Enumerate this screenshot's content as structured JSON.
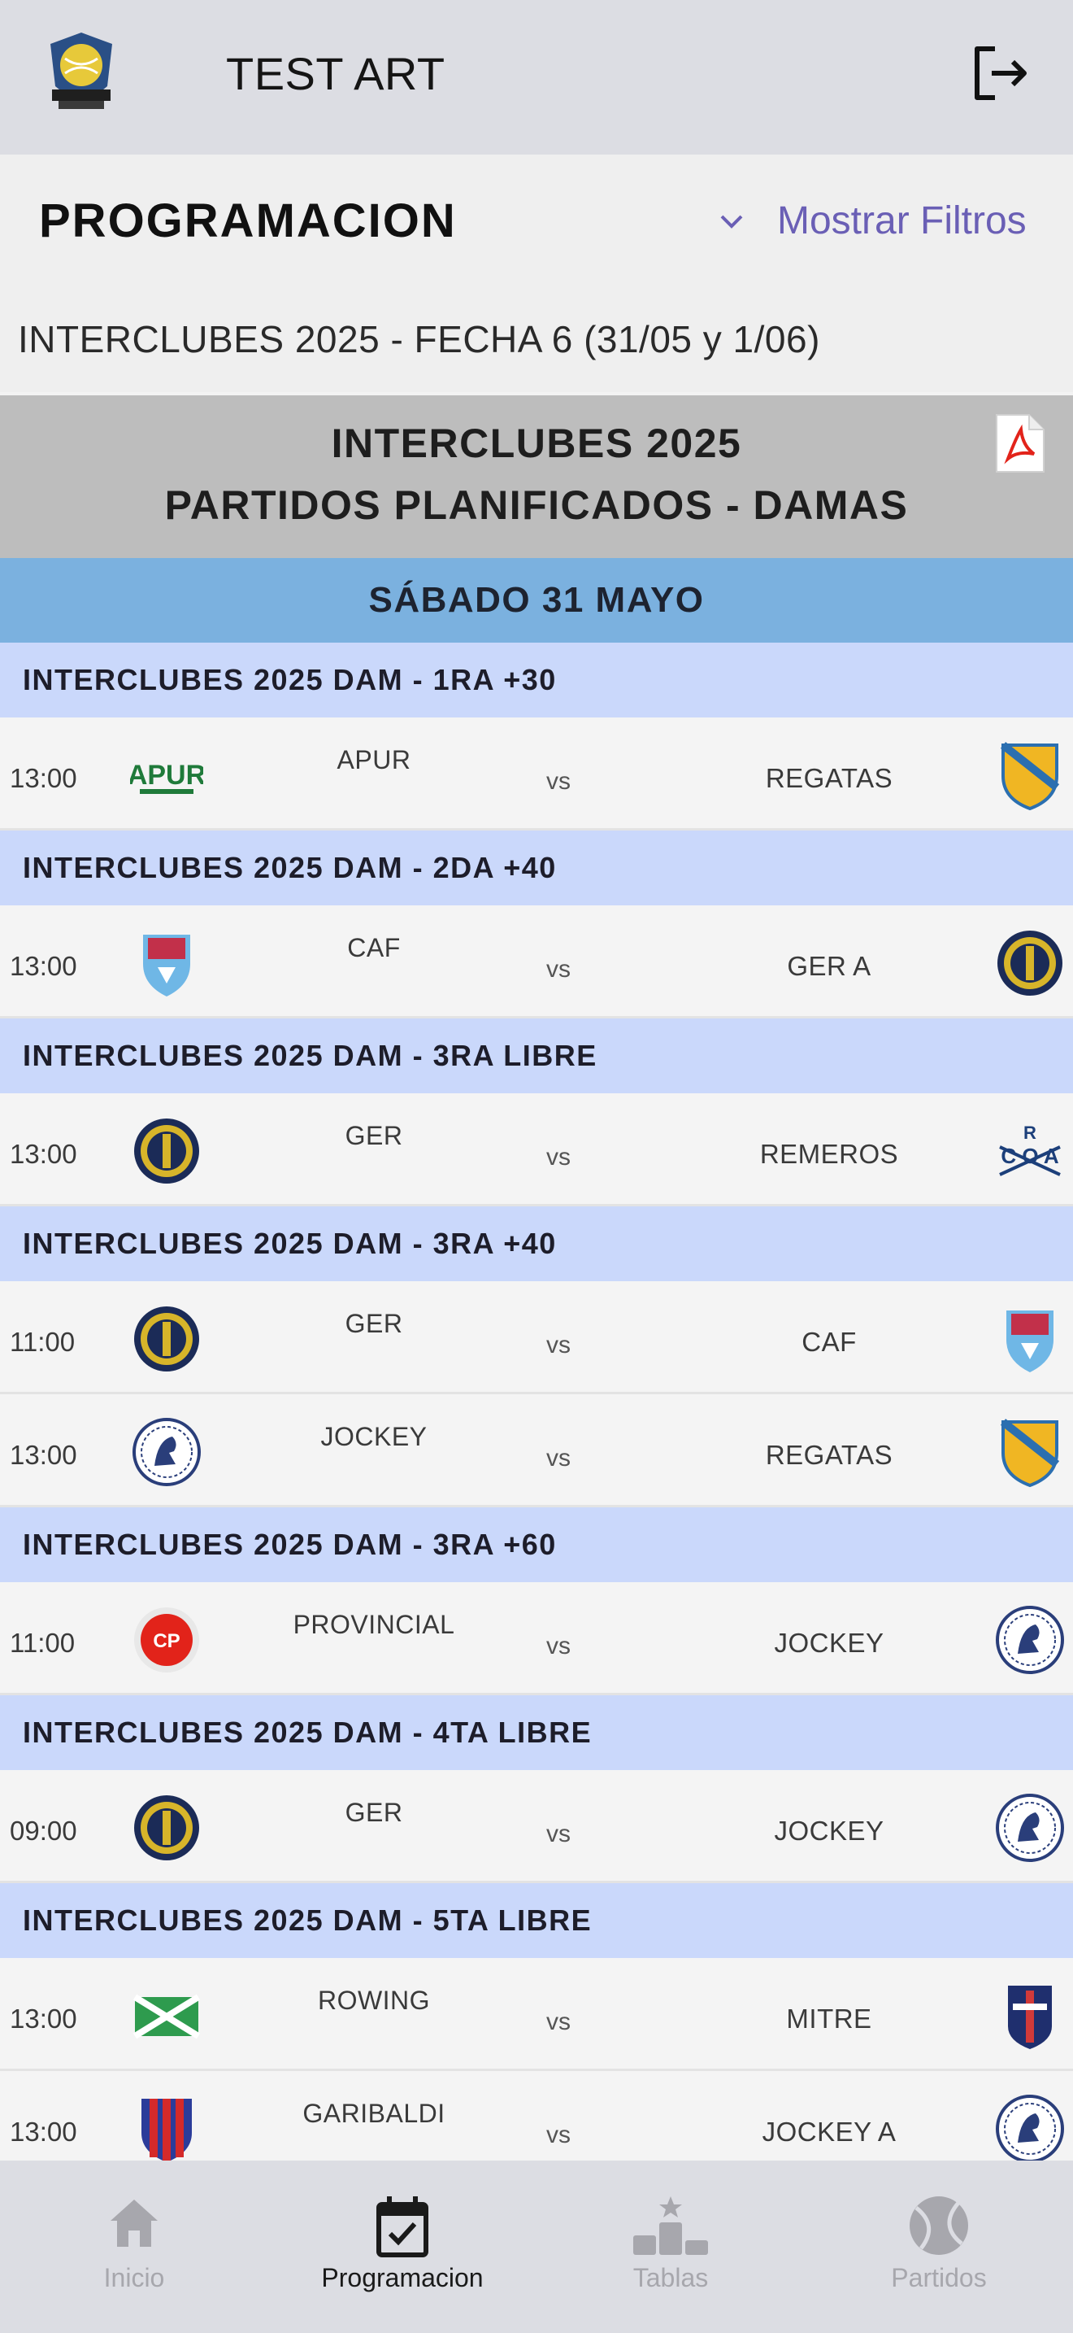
{
  "header": {
    "title": "TEST ART",
    "logo_icon": "tennis-club-logo",
    "logout_icon": "logout-icon"
  },
  "section": {
    "title": "PROGRAMACION",
    "filter_label": "Mostrar Filtros",
    "subtitle": "INTERCLUBES 2025 - FECHA 6 (31/05 y 1/06)"
  },
  "banner": {
    "line1": "INTERCLUBES 2025",
    "line2": "PARTIDOS PLANIFICADOS - DAMAS",
    "pdf_icon": "pdf-icon"
  },
  "day_label": "SÁBADO 31 MAYO",
  "vs_label": "vs",
  "categories": [
    {
      "label": "INTERCLUBES 2025 DAM  - 1RA +30",
      "matches": [
        {
          "time": "13:00",
          "home": "APUR",
          "away": "REGATAS",
          "home_logo": "apur",
          "away_logo": "regatas"
        }
      ]
    },
    {
      "label": "INTERCLUBES 2025 DAM  - 2DA +40",
      "matches": [
        {
          "time": "13:00",
          "home": "CAF",
          "away": "GER A",
          "home_logo": "caf",
          "away_logo": "ger"
        }
      ]
    },
    {
      "label": "INTERCLUBES 2025 DAM  - 3RA  LIBRE",
      "matches": [
        {
          "time": "13:00",
          "home": "GER",
          "away": "REMEROS",
          "home_logo": "ger",
          "away_logo": "remeros"
        }
      ]
    },
    {
      "label": "INTERCLUBES 2025 DAM  - 3RA +40",
      "matches": [
        {
          "time": "11:00",
          "home": "GER",
          "away": "CAF",
          "home_logo": "ger",
          "away_logo": "caf"
        },
        {
          "time": "13:00",
          "home": "JOCKEY",
          "away": "REGATAS",
          "home_logo": "jockey",
          "away_logo": "regatas"
        }
      ]
    },
    {
      "label": "INTERCLUBES 2025 DAM  - 3RA +60",
      "matches": [
        {
          "time": "11:00",
          "home": "PROVINCIAL",
          "away": "JOCKEY",
          "home_logo": "provincial",
          "away_logo": "jockey"
        }
      ]
    },
    {
      "label": "INTERCLUBES 2025 DAM  - 4TA  LIBRE",
      "matches": [
        {
          "time": "09:00",
          "home": "GER",
          "away": "JOCKEY",
          "home_logo": "ger",
          "away_logo": "jockey"
        }
      ]
    },
    {
      "label": "INTERCLUBES 2025 DAM  - 5TA  LIBRE",
      "matches": [
        {
          "time": "13:00",
          "home": "ROWING",
          "away": "MITRE",
          "home_logo": "rowing",
          "away_logo": "mitre"
        },
        {
          "time": "13:00",
          "home": "GARIBALDI",
          "away": "JOCKEY A",
          "home_logo": "garibaldi",
          "away_logo": "jockey"
        }
      ]
    }
  ],
  "bottom_nav": [
    {
      "label": "Inicio",
      "icon": "home-icon",
      "active": false
    },
    {
      "label": "Programacion",
      "icon": "calendar-check-icon",
      "active": true
    },
    {
      "label": "Tablas",
      "icon": "podium-icon",
      "active": false
    },
    {
      "label": "Partidos",
      "icon": "tennis-ball-icon",
      "active": false
    }
  ],
  "colors": {
    "topbar": "#dcdde3",
    "accent": "#6a5fb5",
    "day_bar": "#7bb1df",
    "category_bar": "#cad8fb",
    "banner": "#bdbdbd"
  }
}
